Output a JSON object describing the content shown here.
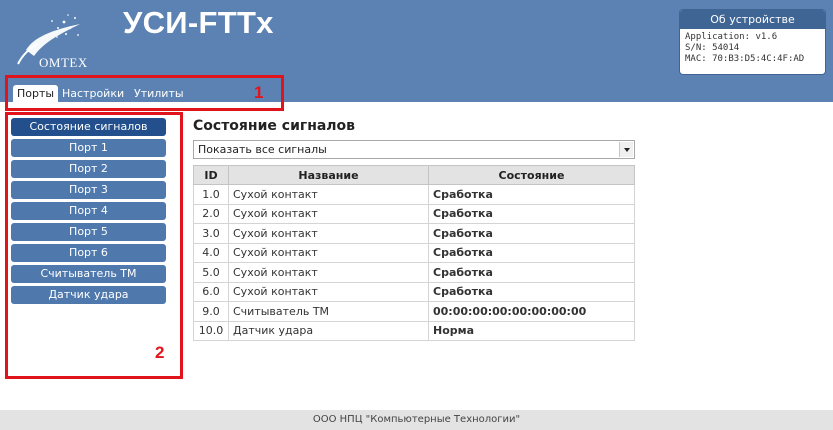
{
  "header": {
    "app_title": "УСИ-FTTx",
    "logo_text": "OMTEX"
  },
  "device_info": {
    "title": "Об устройстве",
    "lines": [
      "Application: v1.6",
      "S/N: 54014",
      "MAC: 70:B3:D5:4C:4F:AD"
    ]
  },
  "tabs": [
    {
      "label": "Порты",
      "active": true
    },
    {
      "label": "Настройки",
      "active": false
    },
    {
      "label": "Утилиты",
      "active": false
    }
  ],
  "annotations": [
    "1",
    "2"
  ],
  "sidebar": {
    "items": [
      {
        "label": "Состояние сигналов",
        "active": true
      },
      {
        "label": "Порт 1"
      },
      {
        "label": "Порт 2"
      },
      {
        "label": "Порт 3"
      },
      {
        "label": "Порт 4"
      },
      {
        "label": "Порт 5"
      },
      {
        "label": "Порт 6"
      },
      {
        "label": "Считыватель ТМ"
      },
      {
        "label": "Датчик удара"
      }
    ]
  },
  "main": {
    "title": "Состояние сигналов",
    "filter_value": "Показать все сигналы",
    "columns": [
      "ID",
      "Название",
      "Состояние"
    ],
    "rows": [
      {
        "id": "1.0",
        "name": "Сухой контакт",
        "state": "Сработка",
        "kind": "alarm"
      },
      {
        "id": "2.0",
        "name": "Сухой контакт",
        "state": "Сработка",
        "kind": "alarm"
      },
      {
        "id": "3.0",
        "name": "Сухой контакт",
        "state": "Сработка",
        "kind": "alarm"
      },
      {
        "id": "4.0",
        "name": "Сухой контакт",
        "state": "Сработка",
        "kind": "alarm"
      },
      {
        "id": "5.0",
        "name": "Сухой контакт",
        "state": "Сработка",
        "kind": "alarm"
      },
      {
        "id": "6.0",
        "name": "Сухой контакт",
        "state": "Сработка",
        "kind": "alarm"
      },
      {
        "id": "9.0",
        "name": "Считыватель ТМ",
        "state": "00:00:00:00:00:00:00:00",
        "kind": "val"
      },
      {
        "id": "10.0",
        "name": "Датчик удара",
        "state": "Норма",
        "kind": "ok"
      }
    ]
  },
  "footer": {
    "text": "ООО НПЦ \"Компьютерные Технологии\""
  },
  "colors": {
    "header_blue": "#5b82b3",
    "sidebar_button": "#4f79ad",
    "sidebar_active": "#23508c",
    "alarm_red": "#d83a3a",
    "ok_green": "#2fa54a",
    "annotation_red": "#e1141c"
  }
}
